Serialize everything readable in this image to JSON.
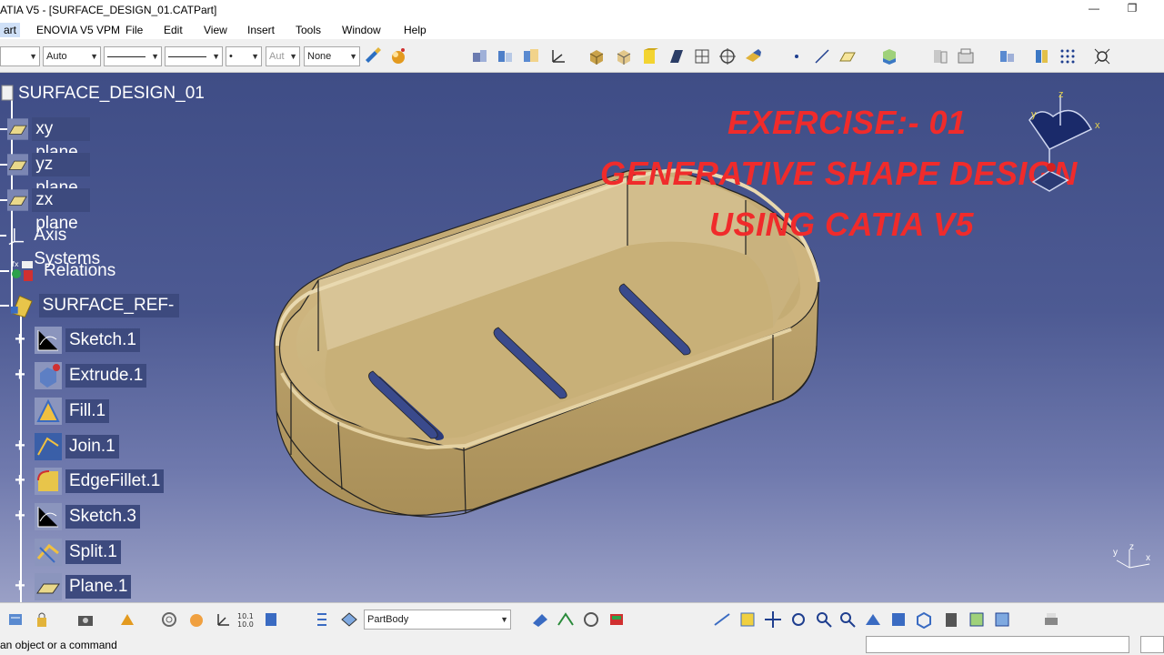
{
  "window": {
    "title": "ATIA V5 - [SURFACE_DESIGN_01.CATPart]",
    "minimize": "—",
    "restore": "❐"
  },
  "menu": {
    "start": "art",
    "items": [
      "ENOVIA V5 VPM",
      "File",
      "Edit",
      "View",
      "Insert",
      "Tools",
      "Window",
      "Help"
    ]
  },
  "toolbar": {
    "combo_color": "",
    "combo_auto": "Auto",
    "combo_aut": "Aut",
    "combo_none": "None",
    "combo_dot": "•"
  },
  "tree": {
    "root": "SURFACE_DESIGN_01",
    "nodes": [
      "xy plane",
      "yz plane",
      "zx plane",
      "Axis Systems",
      "Relations",
      "SURFACE_REF--"
    ],
    "children": [
      "Sketch.1",
      "Extrude.1",
      "Fill.1",
      "Join.1",
      "EdgeFillet.1",
      "Sketch.3",
      "Split.1",
      "Plane.1"
    ]
  },
  "overlay": {
    "line1": "EXERCISE:- 01",
    "line2": "GENERATIVE SHAPE DESIGN",
    "line3": "USING CATIA V5"
  },
  "compass": {
    "z": "z",
    "x": "x",
    "y": "y"
  },
  "mini_axis": {
    "y": "y",
    "z": "z",
    "x": "x"
  },
  "bottom_toolbar": {
    "body_select": "PartBody"
  },
  "status": {
    "text": "an object or a command"
  },
  "colors": {
    "overlay_red": "#f02b2b",
    "part_tan": "#b9a06a",
    "bg_top": "#3f4d86",
    "bg_bottom": "#9aa0c6"
  }
}
